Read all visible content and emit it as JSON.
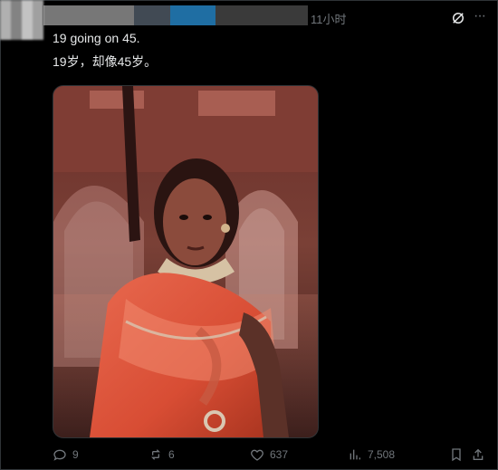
{
  "post": {
    "time": "11小时",
    "text_en": "19 going on 45.",
    "text_zh": "19岁，却像45岁。"
  },
  "actions": {
    "replies": "9",
    "reposts": "6",
    "likes": "637",
    "views": "7,508"
  },
  "icons": {
    "grok": "grok-icon",
    "more": "more-icon",
    "reply": "reply-icon",
    "repost": "repost-icon",
    "like": "heart-icon",
    "views": "views-icon",
    "bookmark": "bookmark-icon",
    "share": "share-icon"
  },
  "colors": {
    "background": "#000000",
    "text": "#e7e9ea",
    "muted": "#71767b"
  }
}
